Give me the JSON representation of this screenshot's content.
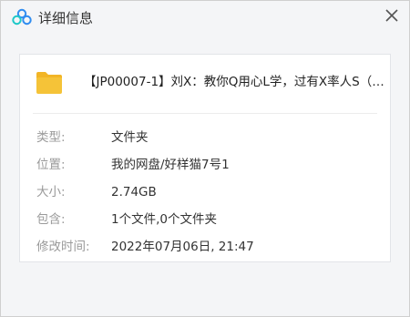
{
  "window": {
    "title": "详细信息"
  },
  "file": {
    "name": "【JP00007-1】刘X：教你Q用心L学，过有X率人S（完..."
  },
  "properties": [
    {
      "label": "类型:",
      "value": "文件夹"
    },
    {
      "label": "位置:",
      "value": "我的网盘/好样猫7号1"
    },
    {
      "label": "大小:",
      "value": "2.74GB"
    },
    {
      "label": "包含:",
      "value": "1个文件,0个文件夹"
    },
    {
      "label": "修改时间:",
      "value": "2022年07月06日, 21:47"
    }
  ],
  "colors": {
    "accent": "#2f8cf0",
    "folder": "#f5c338",
    "label": "#9a9a9a"
  },
  "icons": {
    "app": "cloud-logo-icon",
    "close": "close-icon",
    "folder": "folder-icon"
  }
}
